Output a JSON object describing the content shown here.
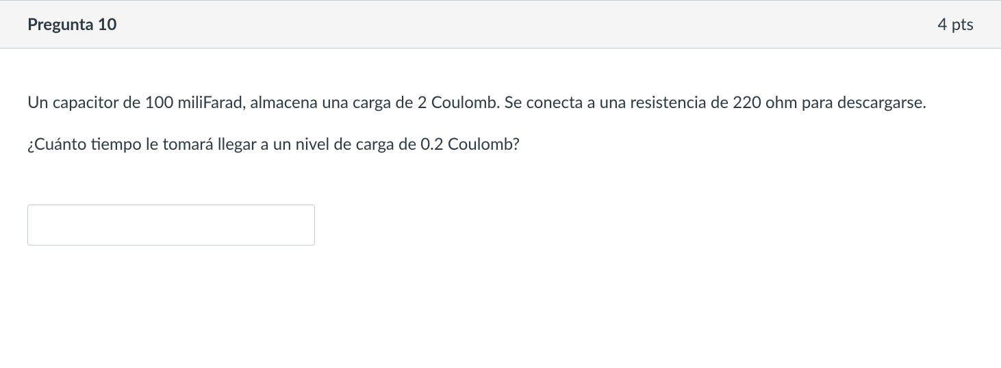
{
  "question": {
    "header": {
      "title": "Pregunta 10",
      "points": "4 pts"
    },
    "body": {
      "paragraph1": "Un capacitor de 100 miliFarad, almacena una carga de 2 Coulomb. Se conecta a una resistencia de 220 ohm para descargarse.",
      "paragraph2": "¿Cuánto tiempo le tomará llegar a un nivel de carga de 0.2 Coulomb?"
    },
    "answer": {
      "value": ""
    }
  }
}
